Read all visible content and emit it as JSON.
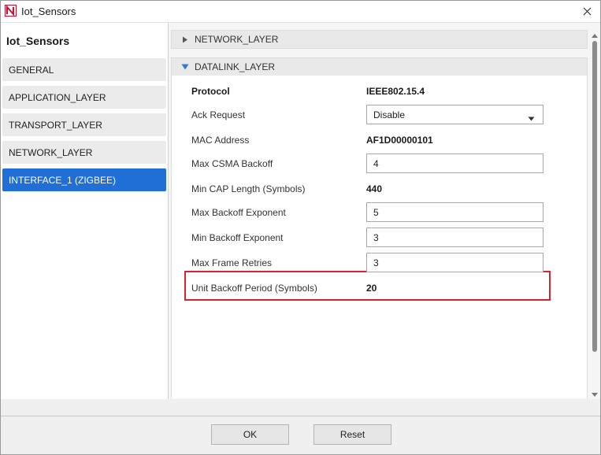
{
  "window": {
    "title": "Iot_Sensors",
    "icon": "netsim-logo-icon",
    "close_icon": "close-icon"
  },
  "sidebar": {
    "title": "Iot_Sensors",
    "items": [
      {
        "label": "GENERAL",
        "selected": false
      },
      {
        "label": "APPLICATION_LAYER",
        "selected": false
      },
      {
        "label": "TRANSPORT_LAYER",
        "selected": false
      },
      {
        "label": "NETWORK_LAYER",
        "selected": false
      },
      {
        "label": "INTERFACE_1 (ZIGBEE)",
        "selected": true
      }
    ]
  },
  "sections": {
    "network_layer": {
      "label": "NETWORK_LAYER",
      "expanded": false
    },
    "datalink_layer": {
      "label": "DATALINK_LAYER",
      "expanded": true
    }
  },
  "properties": {
    "protocol": {
      "label": "Protocol",
      "value": "IEEE802.15.4"
    },
    "ack_request": {
      "label": "Ack Request",
      "value": "Disable"
    },
    "mac_address": {
      "label": "MAC Address",
      "value": "AF1D00000101"
    },
    "max_csma_backoff": {
      "label": "Max CSMA Backoff",
      "value": "4"
    },
    "min_cap_length": {
      "label": "Min CAP Length (Symbols)",
      "value": "440"
    },
    "max_backoff_exponent": {
      "label": "Max Backoff Exponent",
      "value": "5"
    },
    "min_backoff_exponent": {
      "label": "Min Backoff Exponent",
      "value": "3"
    },
    "max_frame_retries": {
      "label": "Max Frame Retries",
      "value": "3"
    },
    "unit_backoff_period": {
      "label": "Unit Backoff Period (Symbols)",
      "value": "20"
    }
  },
  "footer": {
    "ok_label": "OK",
    "reset_label": "Reset"
  },
  "colors": {
    "selected_item": "#1f6fd6",
    "highlight_border": "#d6232d",
    "expanded_triangle": "#2b7fd4",
    "logo_red": "#c8102e"
  }
}
